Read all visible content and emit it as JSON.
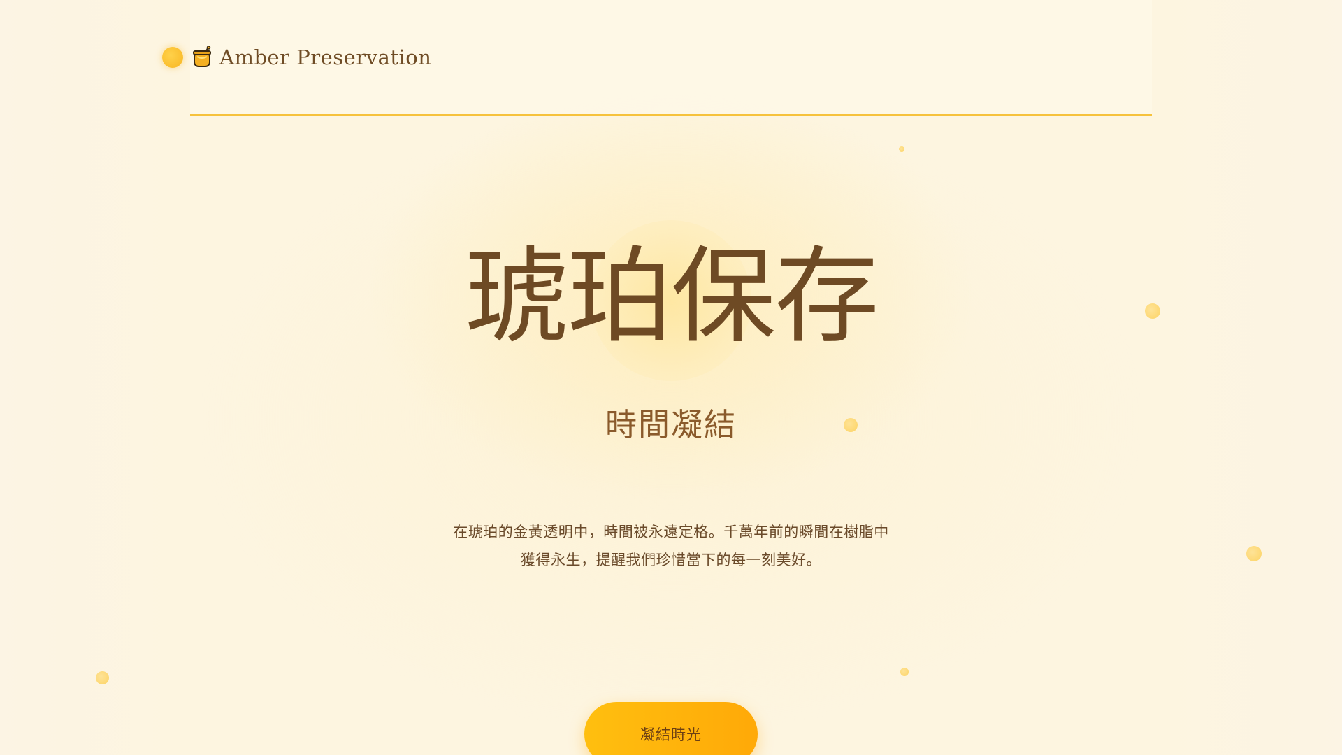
{
  "brand": {
    "name": "Amber Preservation",
    "jar_icon": "honey-jar-icon",
    "dot_icon": "amber-orb-icon"
  },
  "hero": {
    "title": "琥珀保存",
    "subtitle": "時間凝結",
    "description_line1": "在琥珀的金黃透明中，時間被永遠定格。千萬年前的瞬間在樹脂中",
    "description_line2": "獲得永生，提醒我們珍惜當下的每一刻美好。"
  },
  "cta": {
    "label": "凝結時光"
  },
  "colors": {
    "background": "#fdf5e0",
    "accent": "#f6c23c",
    "button": "#ffb80c",
    "text_dark": "#6e4a24",
    "text_mid": "#8a5a2b"
  }
}
